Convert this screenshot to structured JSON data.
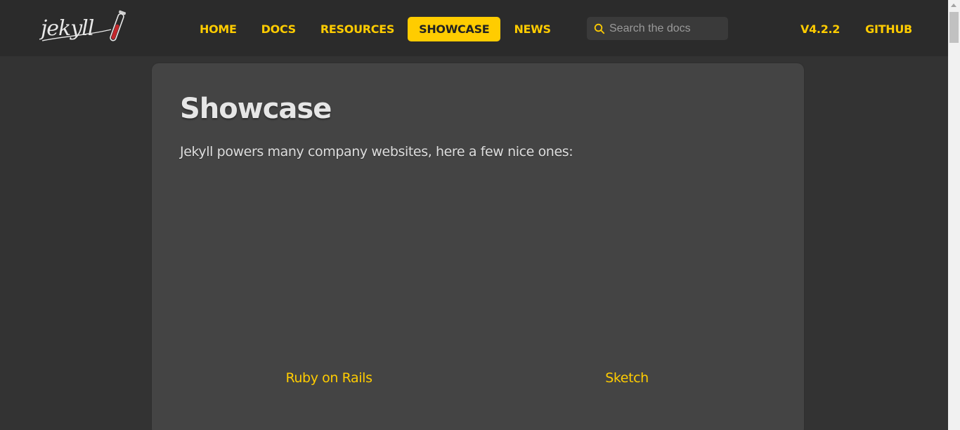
{
  "header": {
    "logo_text": "jekyll",
    "nav": [
      {
        "label": "HOME",
        "active": false
      },
      {
        "label": "DOCS",
        "active": false
      },
      {
        "label": "RESOURCES",
        "active": false
      },
      {
        "label": "SHOWCASE",
        "active": true
      },
      {
        "label": "NEWS",
        "active": false
      }
    ],
    "search": {
      "placeholder": "Search the docs",
      "value": ""
    },
    "meta": {
      "version": "V4.2.2",
      "github": "GITHUB"
    }
  },
  "main": {
    "title": "Showcase",
    "intro": "Jekyll powers many company websites, here a few nice ones:",
    "items": [
      {
        "name": "Ruby on Rails"
      },
      {
        "name": "Sketch"
      }
    ]
  },
  "colors": {
    "accent": "#fc0",
    "header_bg": "#2b2b2b",
    "page_bg": "#333333",
    "card_bg": "#444444",
    "logo_red": "#c3272b"
  },
  "icons": {
    "search": "search-icon",
    "logo": "jekyll-logo"
  }
}
